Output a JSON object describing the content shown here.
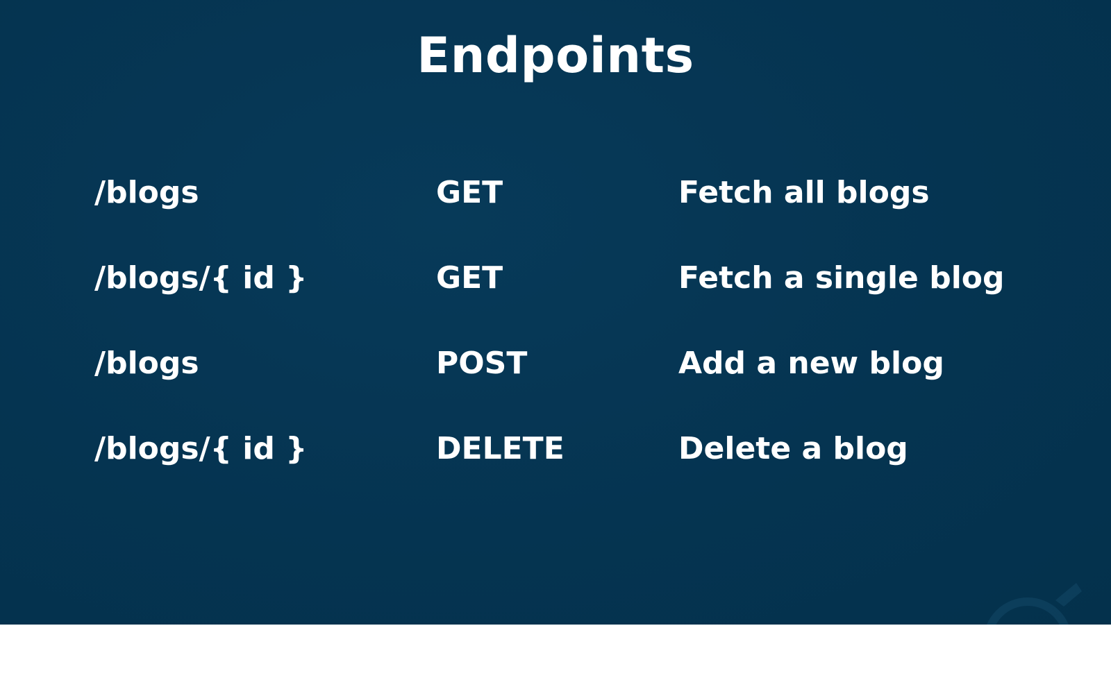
{
  "slide": {
    "title": "Endpoints",
    "background_color": "#053451",
    "text_color": "#ffffff"
  },
  "endpoints": [
    {
      "path": "/blogs",
      "method": "GET",
      "description": "Fetch all blogs"
    },
    {
      "path": "/blogs/{ id }",
      "method": "GET",
      "description": "Fetch a single blog"
    },
    {
      "path": "/blogs",
      "method": "POST",
      "description": "Add a new blog"
    },
    {
      "path": "/blogs/{ id }",
      "method": "DELETE",
      "description": "Delete a blog"
    }
  ],
  "watermark": {
    "icon": "ninja-logo-icon"
  }
}
